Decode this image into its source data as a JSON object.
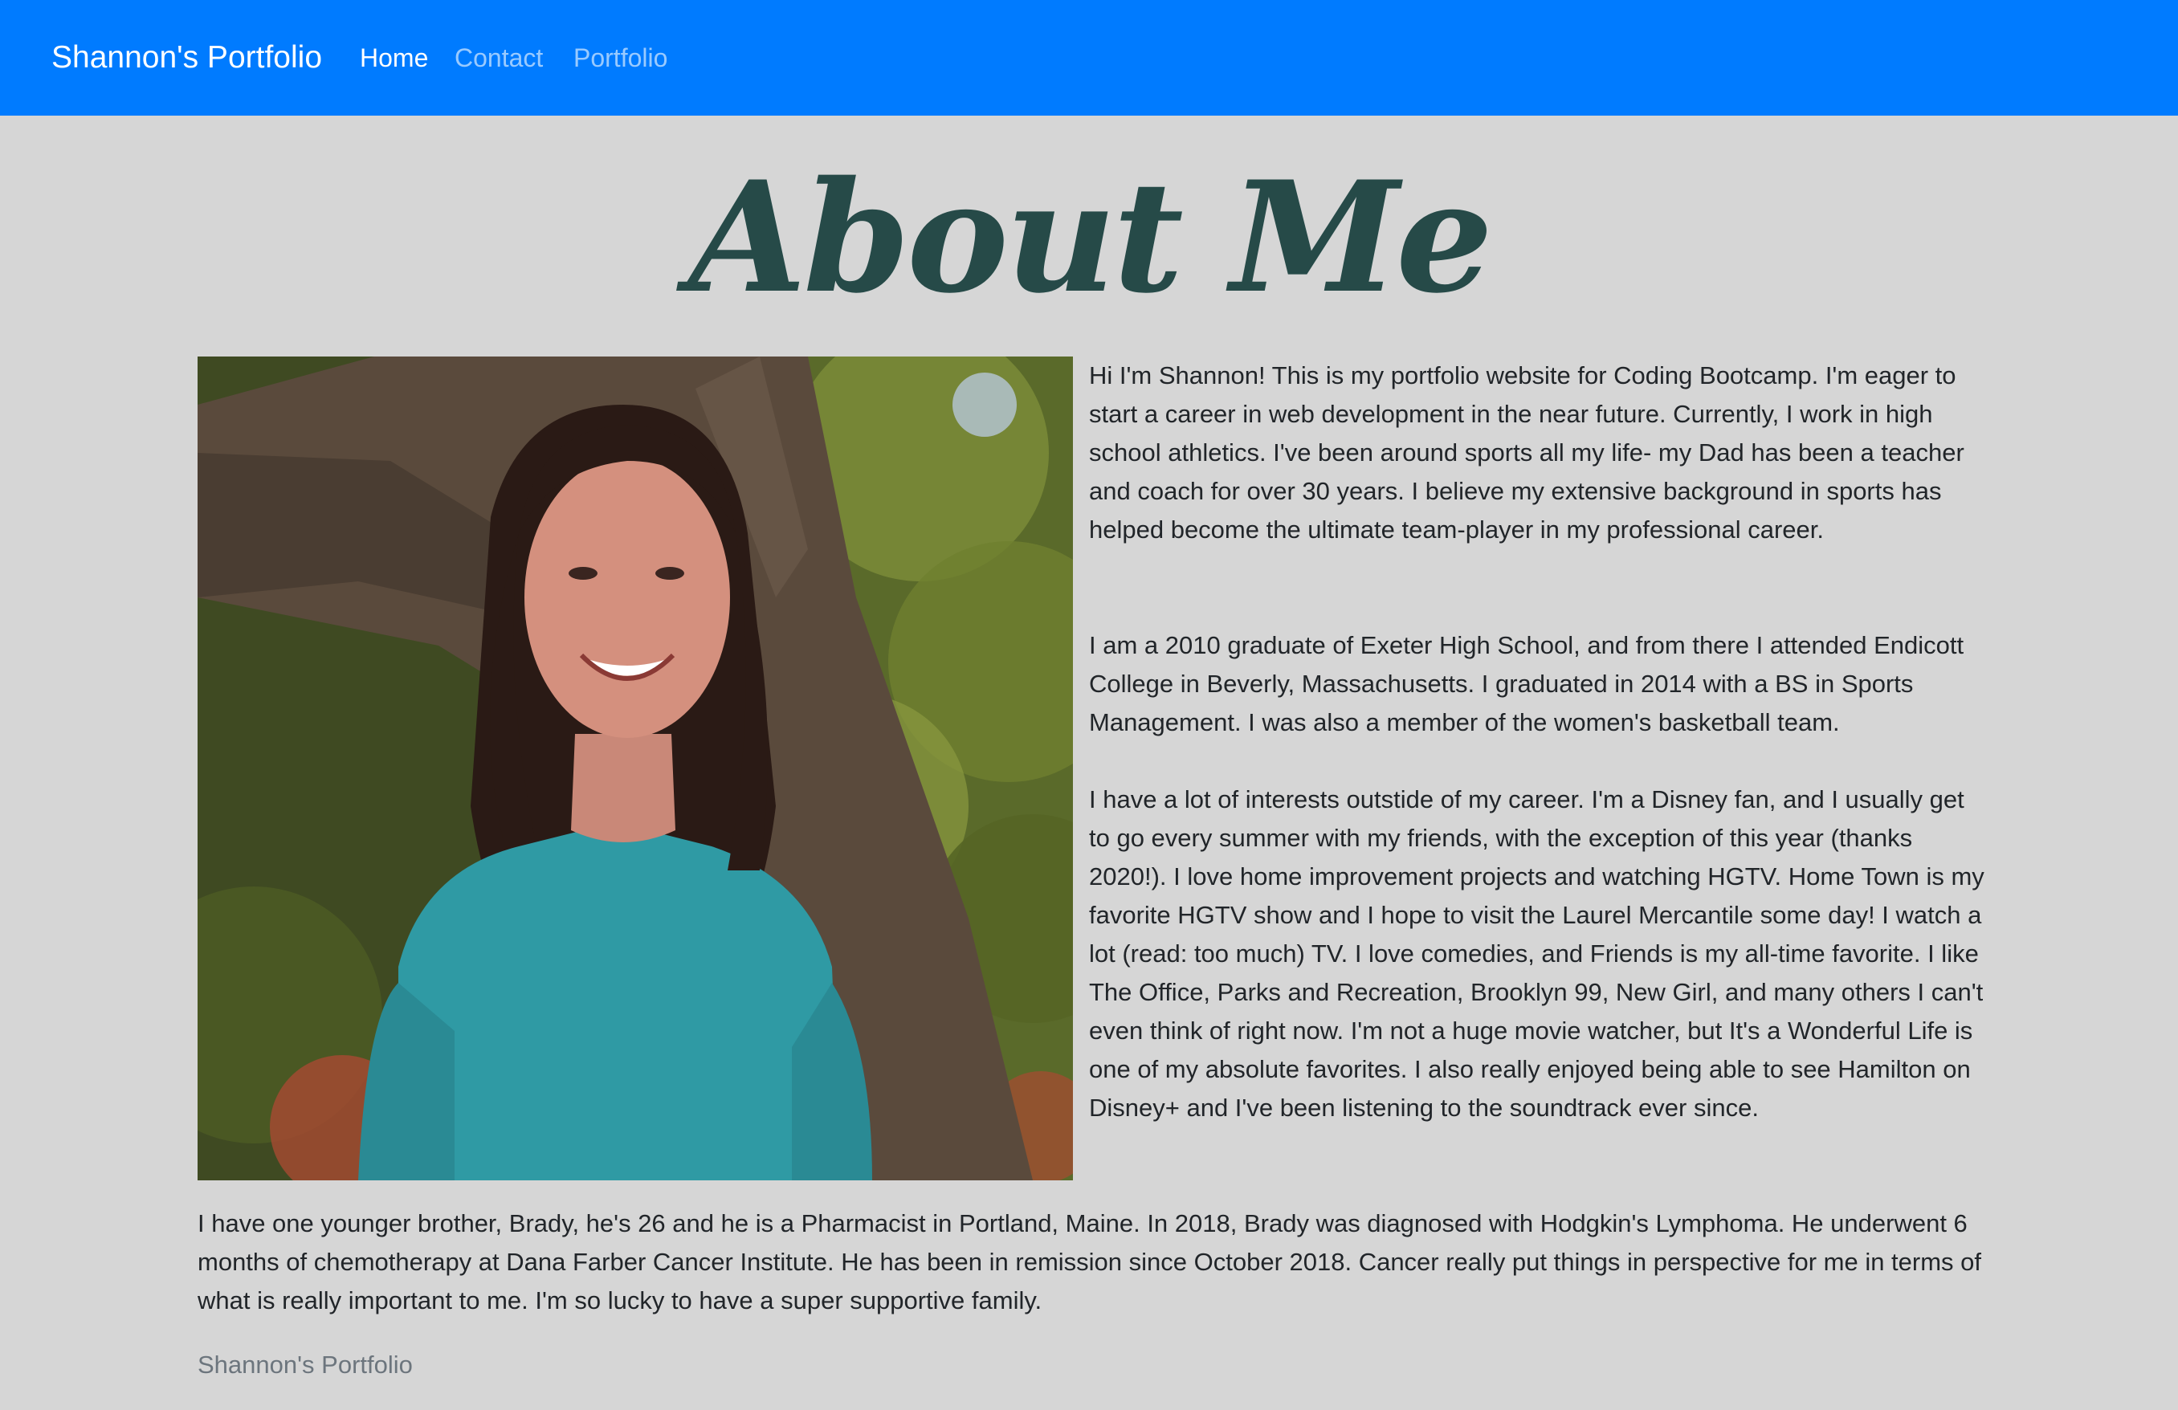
{
  "navbar": {
    "brand": "Shannon's Portfolio",
    "links": [
      {
        "label": "Home",
        "active": true
      },
      {
        "label": "Contact",
        "active": false
      },
      {
        "label": "Portfolio",
        "active": false
      }
    ],
    "background_color": "#007bff"
  },
  "main": {
    "title": "About Me",
    "title_color": "#264a48",
    "photo_description": "Portrait of a smiling woman with long dark hair in a teal long-sleeve shirt standing in front of a large tree trunk",
    "paragraphs": [
      "Hi I'm Shannon! This is my portfolio website for Coding Bootcamp. I'm eager to start a career in web development in the near future. Currently, I work in high school athletics. I've been around sports all my life- my Dad has been a teacher and coach for over 30 years. I believe my extensive background in sports has helped become the ultimate team-player in my professional career.",
      "I am a 2010 graduate of Exeter High School, and from there I attended Endicott College in Beverly, Massachusetts. I graduated in 2014 with a BS in Sports Management. I was also a member of the women's basketball team.",
      "I have a lot of interests outstide of my career. I'm a Disney fan, and I usually get to go every summer with my friends, with the exception of this year (thanks 2020!). I love home improvement projects and watching HGTV. Home Town is my favorite HGTV show and I hope to visit the Laurel Mercantile some day! I watch a lot (read: too much) TV. I love comedies, and Friends is my all-time favorite. I like The Office, Parks and Recreation, Brooklyn 99, New Girl, and many others I can't even think of right now. I'm not a huge movie watcher, but It's a Wonderful Life is one of my absolute favorites. I also really enjoyed being able to see Hamilton on Disney+ and I've been listening to the soundtrack ever since.",
      "I have one younger brother, Brady, he's 26 and he is a Pharmacist in Portland, Maine. In 2018, Brady was diagnosed with Hodgkin's Lymphoma. He underwent 6 months of chemotherapy at Dana Farber Cancer Institute. He has been in remission since October 2018. Cancer really put things in perspective for me in terms of what is really important to me. I'm so lucky to have a super supportive family."
    ]
  },
  "footer": {
    "text": "Shannon's Portfolio"
  }
}
